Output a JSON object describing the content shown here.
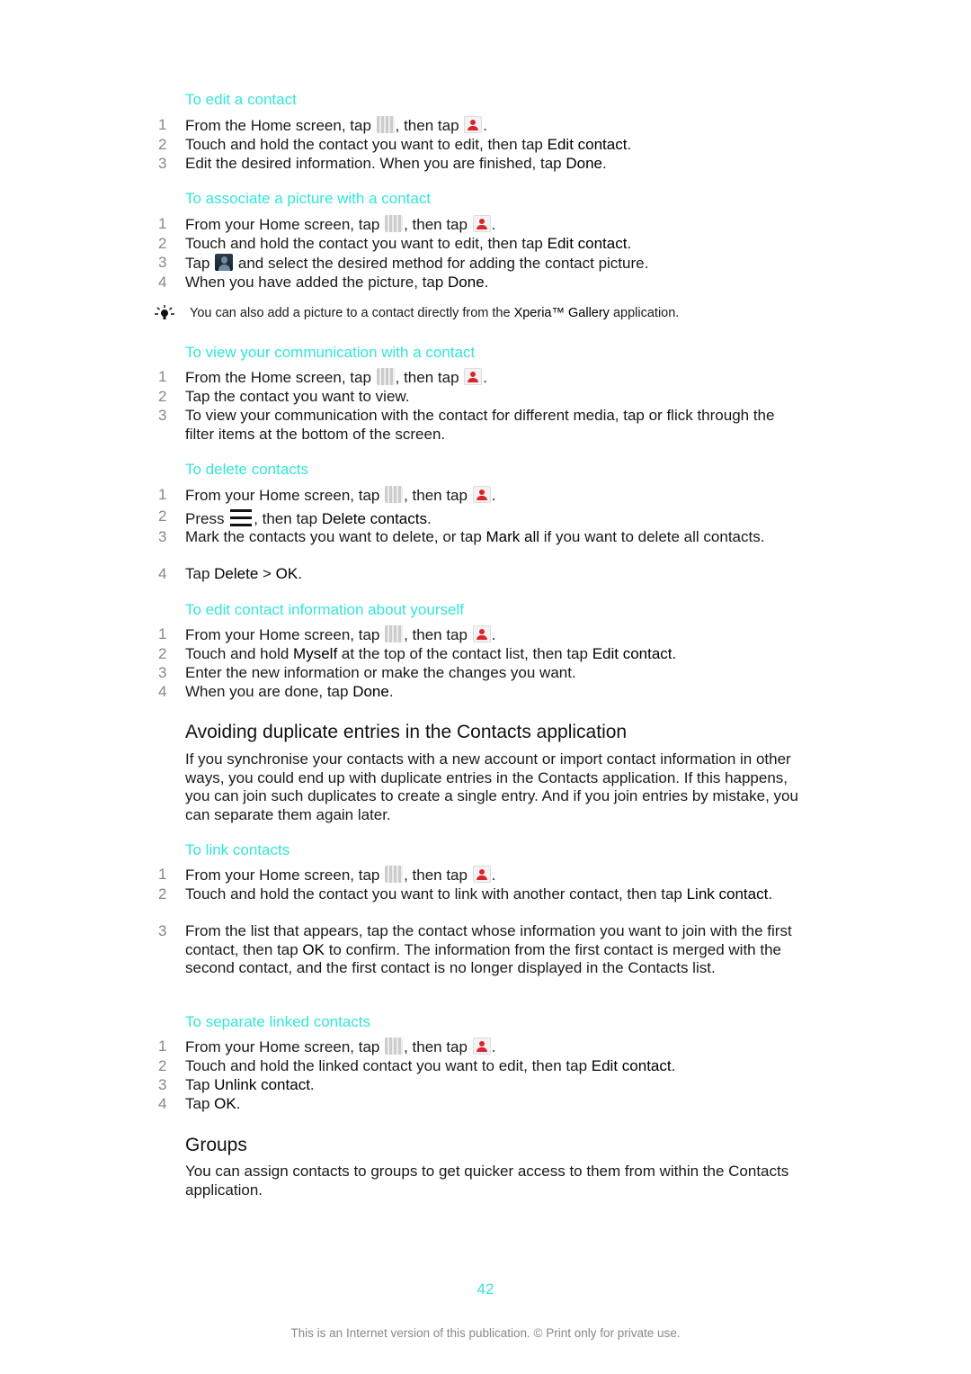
{
  "sections": [
    {
      "title": "To edit a contact",
      "steps": [
        [
          "From the Home screen, tap ",
          "ICON_GRID",
          ", then tap ",
          "ICON_PERSON",
          "."
        ],
        [
          "Touch and hold the contact you want to edit, then tap ",
          "B:Edit contact",
          "."
        ],
        [
          "Edit the desired information. When you are finished, tap ",
          "B:Done",
          "."
        ]
      ]
    },
    {
      "title": "To associate a picture with a contact",
      "steps": [
        [
          "From your Home screen, tap ",
          "ICON_GRID",
          ", then tap ",
          "ICON_PERSON",
          "."
        ],
        [
          "Touch and hold the contact you want to edit, then tap ",
          "B:Edit contact",
          "."
        ],
        [
          "Tap ",
          "ICON_PHOTO",
          " and select the desired method for adding the contact picture."
        ],
        [
          "When you have added the picture, tap ",
          "B:Done",
          "."
        ]
      ]
    },
    {
      "title": "To view your communication with a contact",
      "steps": [
        [
          "From the Home screen, tap ",
          "ICON_GRID",
          ", then tap ",
          "ICON_PERSON",
          "."
        ],
        [
          "Tap the contact you want to view."
        ],
        [
          "To view your communication with the contact for different media, tap or flick through the filter items at the bottom of the screen."
        ]
      ]
    },
    {
      "title": "To delete contacts",
      "steps": [
        [
          "From your Home screen, tap ",
          "ICON_GRID",
          ", then tap ",
          "ICON_PERSON",
          "."
        ],
        [
          "Press ",
          "ICON_MENU",
          ", then tap ",
          "B:Delete contacts",
          "."
        ],
        [
          "Mark the contacts you want to delete, or tap ",
          "B:Mark all",
          " if you want to delete all contacts."
        ],
        [
          "Tap ",
          "B:Delete",
          " > ",
          "B:OK",
          "."
        ]
      ]
    },
    {
      "title": "To edit contact information about yourself",
      "steps": [
        [
          "From your Home screen, tap ",
          "ICON_GRID",
          ", then tap ",
          "ICON_PERSON",
          "."
        ],
        [
          "Touch and hold ",
          "B:Myself",
          " at the top of the contact list, then tap ",
          "B:Edit contact",
          "."
        ],
        [
          "Enter the new information or make the changes you want."
        ],
        [
          "When you are done, tap ",
          "B:Done",
          "."
        ]
      ]
    },
    {
      "title": "To link contacts",
      "steps": [
        [
          "From your Home screen, tap ",
          "ICON_GRID",
          ", then tap ",
          "ICON_PERSON",
          "."
        ],
        [
          "Touch and hold the contact you want to link with another contact, then tap ",
          "B:Link contact",
          "."
        ],
        [
          "From the list that appears, tap the contact whose information you want to join with the first contact, then tap ",
          "B:OK",
          " to confirm. The information from the first contact is merged with the second contact, and the first contact is no longer displayed in the Contacts list."
        ]
      ]
    },
    {
      "title": "To separate linked contacts",
      "steps": [
        [
          "From your Home screen, tap ",
          "ICON_GRID",
          ", then tap ",
          "ICON_PERSON",
          "."
        ],
        [
          "Touch and hold the linked contact you want to edit, then tap ",
          "B:Edit contact",
          "."
        ],
        [
          "Tap ",
          "B:Unlink contact",
          "."
        ],
        [
          "Tap ",
          "B:OK",
          "."
        ]
      ]
    }
  ],
  "tip": {
    "icon": "lightbulb-icon",
    "parts": [
      "You can also add a picture to a contact directly from the ",
      "B:Xperia™ Gallery",
      " application."
    ]
  },
  "avoiding": {
    "heading": "Avoiding duplicate entries in the Contacts application",
    "body": "If you synchronise your contacts with a new account or import contact information in other ways, you could end up with duplicate entries in the Contacts application. If this happens, you can join such duplicates to create a single entry. And if you join entries by mistake, you can separate them again later."
  },
  "groups": {
    "heading": "Groups",
    "body": "You can assign contacts to groups to get quicker access to them from within the Contacts application."
  },
  "page_number": "42",
  "footer": "This is an Internet version of this publication. © Print only for private use.",
  "colors": {
    "heading_accent": "#33e6d8",
    "step_number": "#888888"
  }
}
